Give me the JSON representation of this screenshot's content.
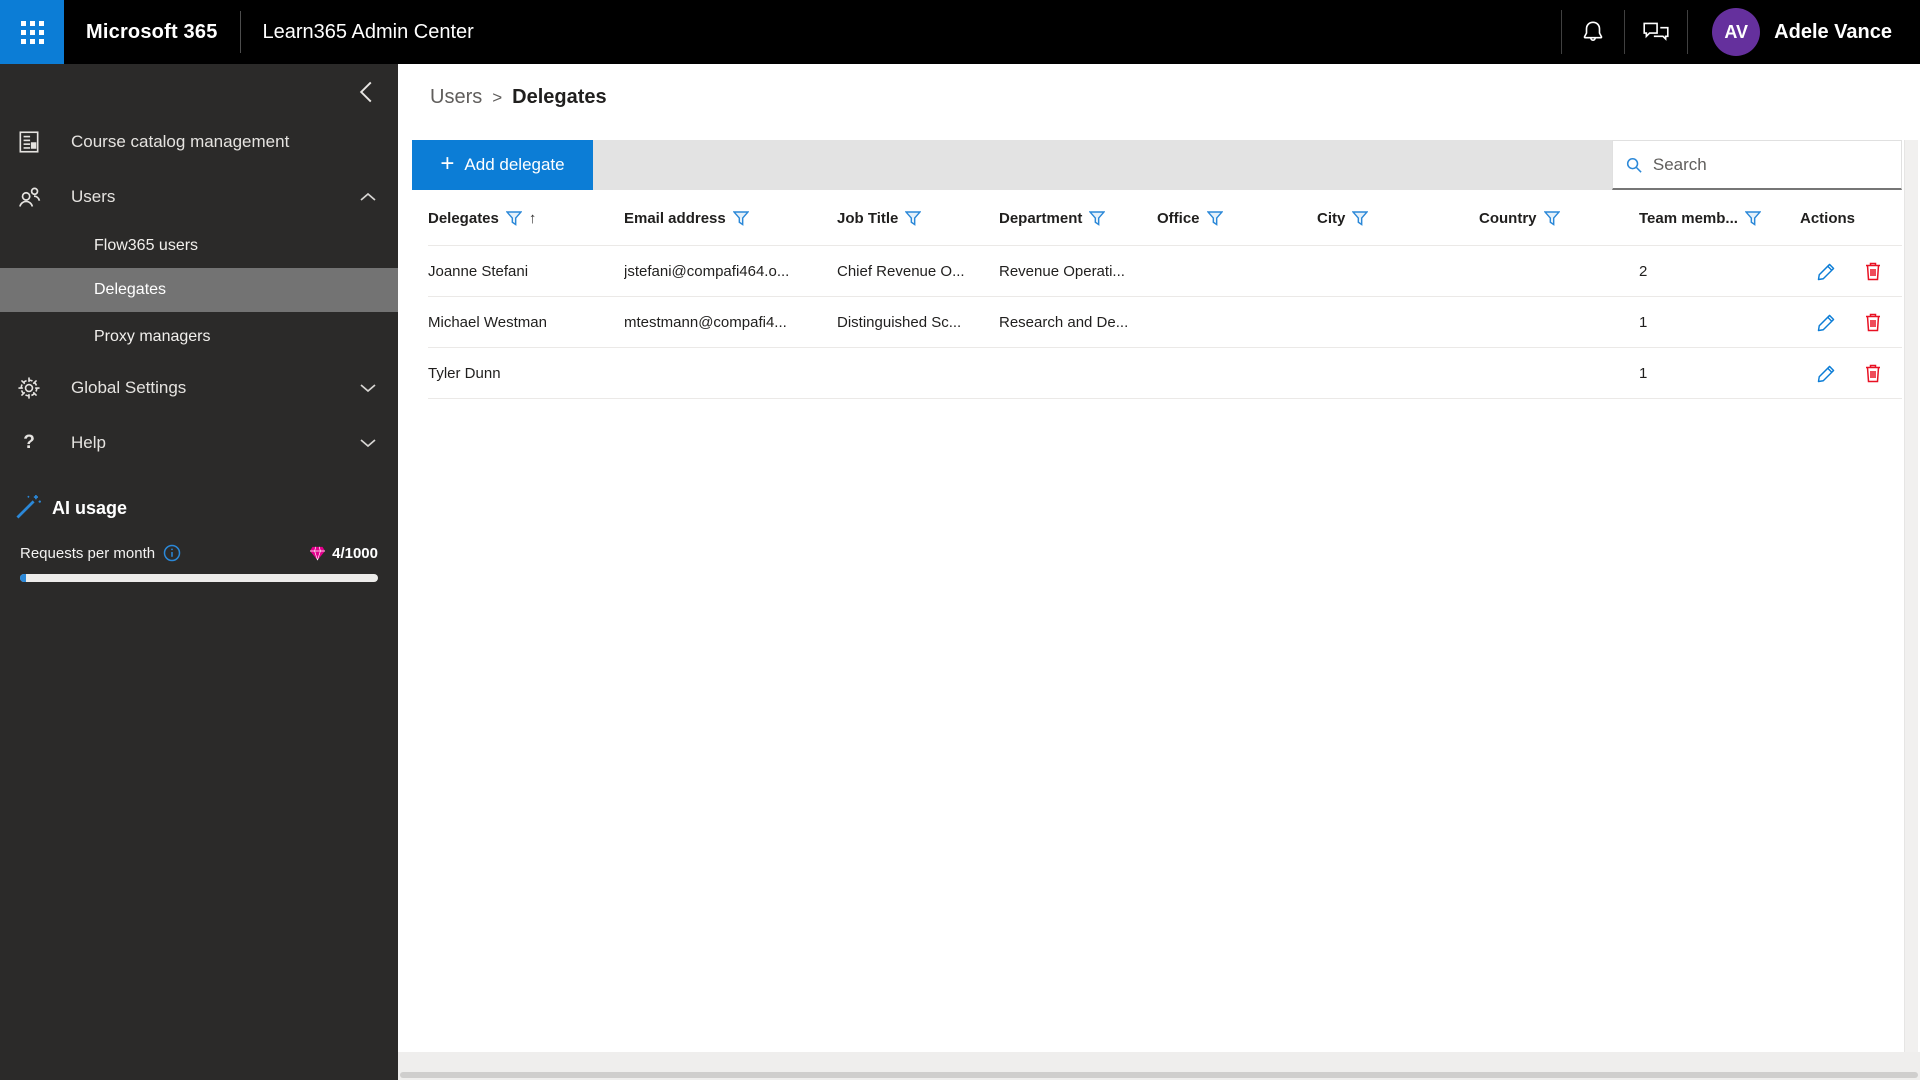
{
  "app_bar": {
    "product_name": "Microsoft 365",
    "app_title": "Learn365 Admin Center",
    "user_initials": "AV",
    "user_name": "Adele Vance"
  },
  "sidebar": {
    "items": {
      "course_catalog": "Course catalog management",
      "users": "Users",
      "flow365_users": "Flow365 users",
      "delegates": "Delegates",
      "proxy_managers": "Proxy managers",
      "global_settings": "Global Settings",
      "help": "Help",
      "help_glyph": "?"
    },
    "ai": {
      "title": "AI usage",
      "requests_label": "Requests per month",
      "usage_value": "4/1000",
      "used": 4,
      "limit": 1000
    }
  },
  "breadcrumb": {
    "parent": "Users",
    "separator": ">",
    "current": "Delegates"
  },
  "toolbar": {
    "add_icon_glyph": "+",
    "add_delegate_label": "Add delegate",
    "search_placeholder": "Search"
  },
  "table": {
    "columns": [
      {
        "label": "Delegates",
        "filter": true,
        "sort_indicator": "↑"
      },
      {
        "label": "Email address",
        "filter": true
      },
      {
        "label": "Job Title",
        "filter": true
      },
      {
        "label": "Department",
        "filter": true
      },
      {
        "label": "Office",
        "filter": true
      },
      {
        "label": "City",
        "filter": true
      },
      {
        "label": "Country",
        "filter": true
      },
      {
        "label": "Team memb...",
        "filter": true
      },
      {
        "label": "Actions",
        "filter": false
      }
    ],
    "rows": [
      {
        "name": "Joanne Stefani",
        "email": "jstefani@compafi464.o...",
        "job_title": "Chief Revenue O...",
        "department": "Revenue Operati...",
        "office": "",
        "city": "",
        "country": "",
        "team_members": "2"
      },
      {
        "name": "Michael Westman",
        "email": "mtestmann@compafi4...",
        "job_title": "Distinguished Sc...",
        "department": "Research and De...",
        "office": "",
        "city": "",
        "country": "",
        "team_members": "1"
      },
      {
        "name": "Tyler Dunn",
        "email": "",
        "job_title": "",
        "department": "",
        "office": "",
        "city": "",
        "country": "",
        "team_members": "1"
      }
    ]
  },
  "colors": {
    "accent_blue": "#0c7dd6",
    "topbar_black": "#000000",
    "sidebar_bg": "#2b2a29",
    "sidebar_selected": "#737373",
    "avatar_purple": "#65309d",
    "gem_magenta": "#e3008c",
    "delete_red": "#e81123",
    "filter_blue": "#2b88d8"
  }
}
